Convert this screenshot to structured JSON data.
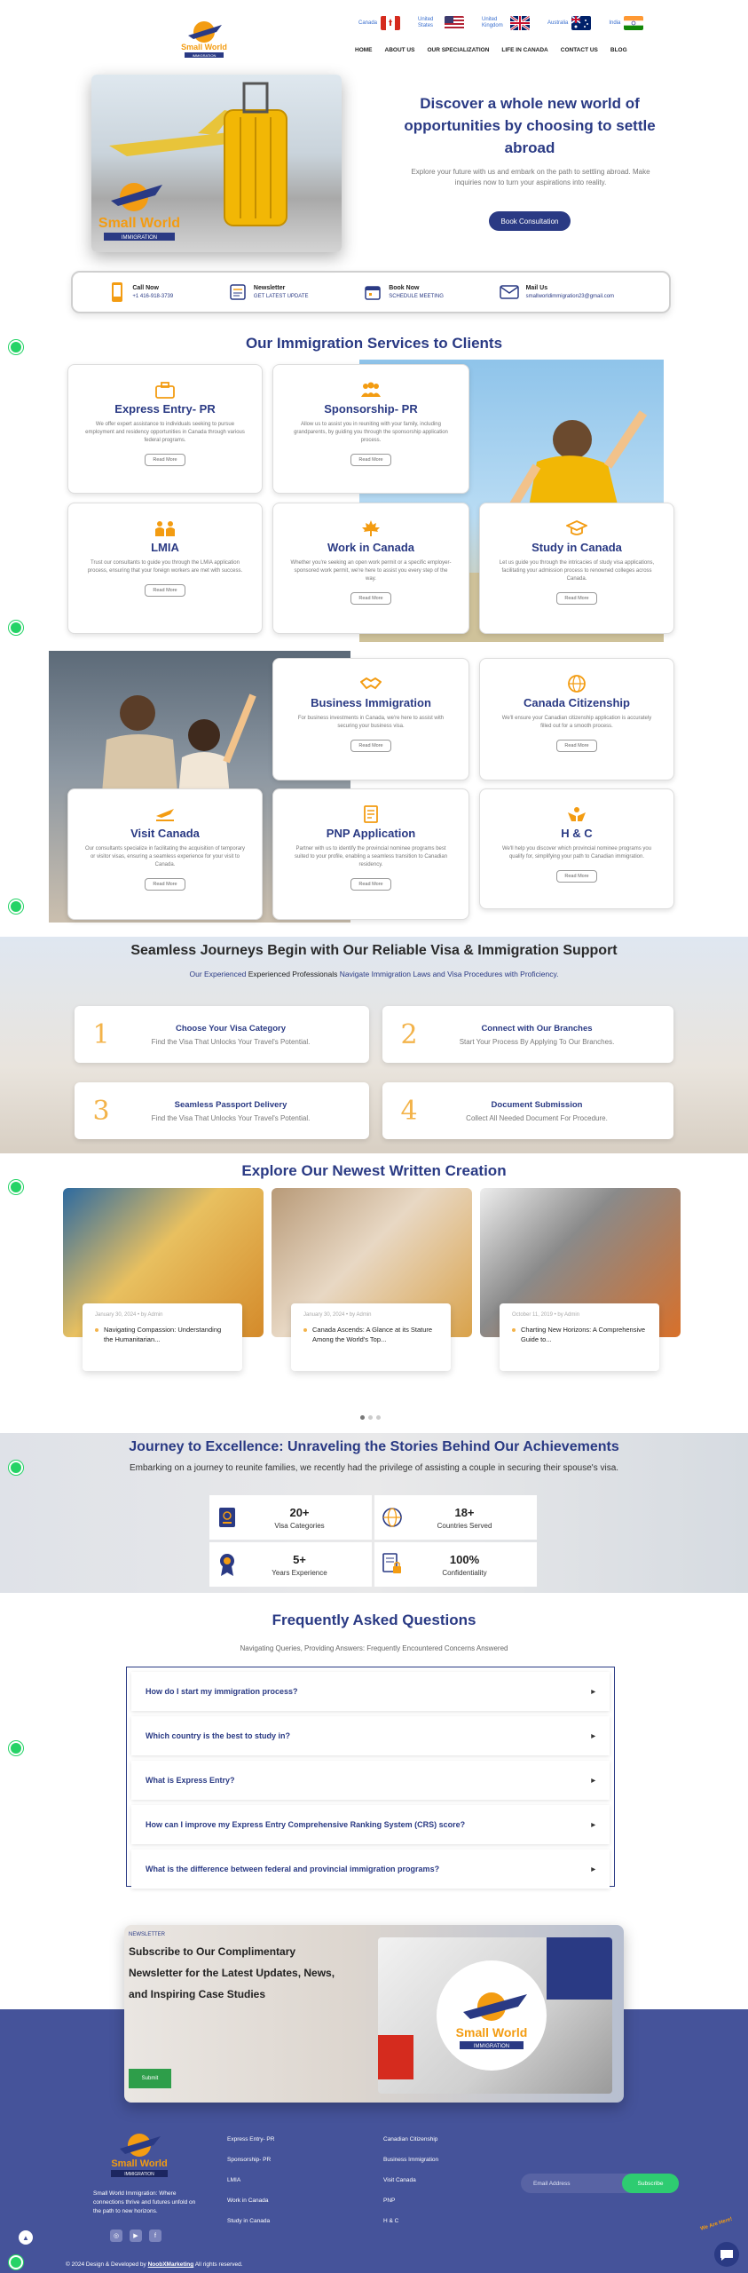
{
  "brand": {
    "name": "Small World",
    "tagline": "IMMIGRATION"
  },
  "flags": [
    {
      "label": "Canada"
    },
    {
      "label": "United States"
    },
    {
      "label": "United Kingdom"
    },
    {
      "label": "Australia"
    },
    {
      "label": "India"
    }
  ],
  "nav": [
    "HOME",
    "ABOUT US",
    "OUR SPECIALIZATION",
    "LIFE IN CANADA",
    "CONTACT US",
    "BLOG"
  ],
  "hero": {
    "title": "Discover a whole new world of opportunities by choosing to settle abroad",
    "subtitle": "Explore your future with us and embark on the path to settling abroad. Make inquiries now to turn your aspirations into reality.",
    "button": "Book Consultation"
  },
  "contact_bar": [
    {
      "title": "Call Now",
      "sub": "+1 416-918-3739"
    },
    {
      "title": "Newsletter",
      "sub": "GET LATEST UPDATE"
    },
    {
      "title": "Book Now",
      "sub": "SCHEDULE MEETING"
    },
    {
      "title": "Mail Us",
      "sub": "smallworldimmigration23@gmail.com"
    }
  ],
  "services": {
    "title": "Our Immigration Services to Clients",
    "read_more": "Read More",
    "items": [
      {
        "title": "Express Entry- PR",
        "text": "We offer expert assistance to individuals seeking to pursue employment and residency opportunities in Canada through various federal programs."
      },
      {
        "title": "Sponsorship- PR",
        "text": "Allow us to assist you in reuniting with your family, including grandparents, by guiding you through the sponsorship application process."
      },
      {
        "title": "LMIA",
        "text": "Trust our consultants to guide you through the LMIA application process, ensuring that your foreign workers are met with success."
      },
      {
        "title": "Work in Canada",
        "text": "Whether you're seeking an open work permit or a specific employer-sponsored work permit, we're here to assist you every step of the way."
      },
      {
        "title": "Study in Canada",
        "text": "Let us guide you through the intricacies of study visa applications, facilitating your admission process to renowned colleges across Canada."
      },
      {
        "title": "Business Immigration",
        "text": "For business investments in Canada, we're here to assist with securing your business visa."
      },
      {
        "title": "Canada Citizenship",
        "text": "We'll ensure your Canadian citizenship application is accurately filled out for a smooth process."
      },
      {
        "title": "Visit Canada",
        "text": "Our consultants specialize in facilitating the acquisition of temporary or visitor visas, ensuring a seamless experience for your visit to Canada."
      },
      {
        "title": "PNP Application",
        "text": "Partner with us to identify the provincial nominee programs best suited to your profile, enabling a seamless transition to Canadian residency."
      },
      {
        "title": "H & C",
        "text": "We'll help you discover which provincial nominee programs you qualify for, simplifying your path to Canadian immigration."
      }
    ]
  },
  "journeys": {
    "title": "Seamless Journeys Begin with Our Reliable Visa & Immigration Support",
    "sub_a": "Our Experienced",
    "sub_b": "Experienced Professionals",
    "sub_c": "Navigate Immigration Laws and Visa Procedures with Proficiency.",
    "steps": [
      {
        "num": "1",
        "title": "Choose Your Visa Category",
        "text": "Find the Visa That Unlocks Your Travel's Potential."
      },
      {
        "num": "2",
        "title": "Connect with Our Branches",
        "text": "Start Your Process By Applying To Our Branches."
      },
      {
        "num": "3",
        "title": "Seamless Passport Delivery",
        "text": "Find the Visa That Unlocks Your Travel's Potential."
      },
      {
        "num": "4",
        "title": "Document Submission",
        "text": "Collect All Needed Document For Procedure."
      }
    ]
  },
  "blog": {
    "title": "Explore Our Newest Written Creation",
    "posts": [
      {
        "meta": "January 30, 2024  •  by Admin",
        "title": "Navigating Compassion: Understanding the Humanitarian..."
      },
      {
        "meta": "January 30, 2024  •  by Admin",
        "title": "Canada Ascends: A Glance at its Stature Among the World's Top..."
      },
      {
        "meta": "October 11, 2019  •  by Admin",
        "title": "Charting New Horizons: A Comprehensive Guide to..."
      }
    ]
  },
  "achievements": {
    "title": "Journey to Excellence: Unraveling the Stories Behind Our Achievements",
    "subtitle": "Embarking on a journey to reunite families, we recently had the privilege of assisting a couple in securing their spouse's visa.",
    "stats": [
      {
        "value": "20+",
        "label": "Visa Categories"
      },
      {
        "value": "18+",
        "label": "Countries Served"
      },
      {
        "value": "5+",
        "label": "Years Experience"
      },
      {
        "value": "100%",
        "label": "Confidentiality"
      }
    ]
  },
  "faq": {
    "title": "Frequently Asked Questions",
    "subtitle": "Navigating Queries, Providing Answers: Frequently Encountered Concerns Answered",
    "items": [
      "How do I start my immigration process?",
      "Which country is the best to study in?",
      "What is Express Entry?",
      "How can I improve my Express Entry Comprehensive Ranking System (CRS) score?",
      "What is the difference between federal and provincial immigration programs?"
    ]
  },
  "newsletter": {
    "tag": "NEWSLETTER",
    "heading": "Subscribe to Our Complimentary Newsletter for the Latest Updates, News, and Inspiring Case Studies",
    "button": "Submit"
  },
  "footer": {
    "about": "Small World Immigration: Where connections thrive and futures unfold on the path to new horizons.",
    "col1": [
      "Express Entry- PR",
      "Sponsorship- PR",
      "LMIA",
      "Work in Canada",
      "Study in Canada"
    ],
    "col2": [
      "Canadian Citizenship",
      "Business Immigration",
      "Visit Canada",
      "PNP",
      "H & C"
    ],
    "email_placeholder": "Email Address",
    "subscribe": "Subscribe",
    "copyright_a": "© 2024 Design & Developed by",
    "copyright_b": "NoobXMarketing",
    "copyright_c": "All rights reserved.",
    "chat_badge": "We Are Here!"
  },
  "colors": {
    "navy": "#2a3a84",
    "orange": "#f39c12",
    "footer": "#45539a",
    "green": "#2ecc71"
  }
}
